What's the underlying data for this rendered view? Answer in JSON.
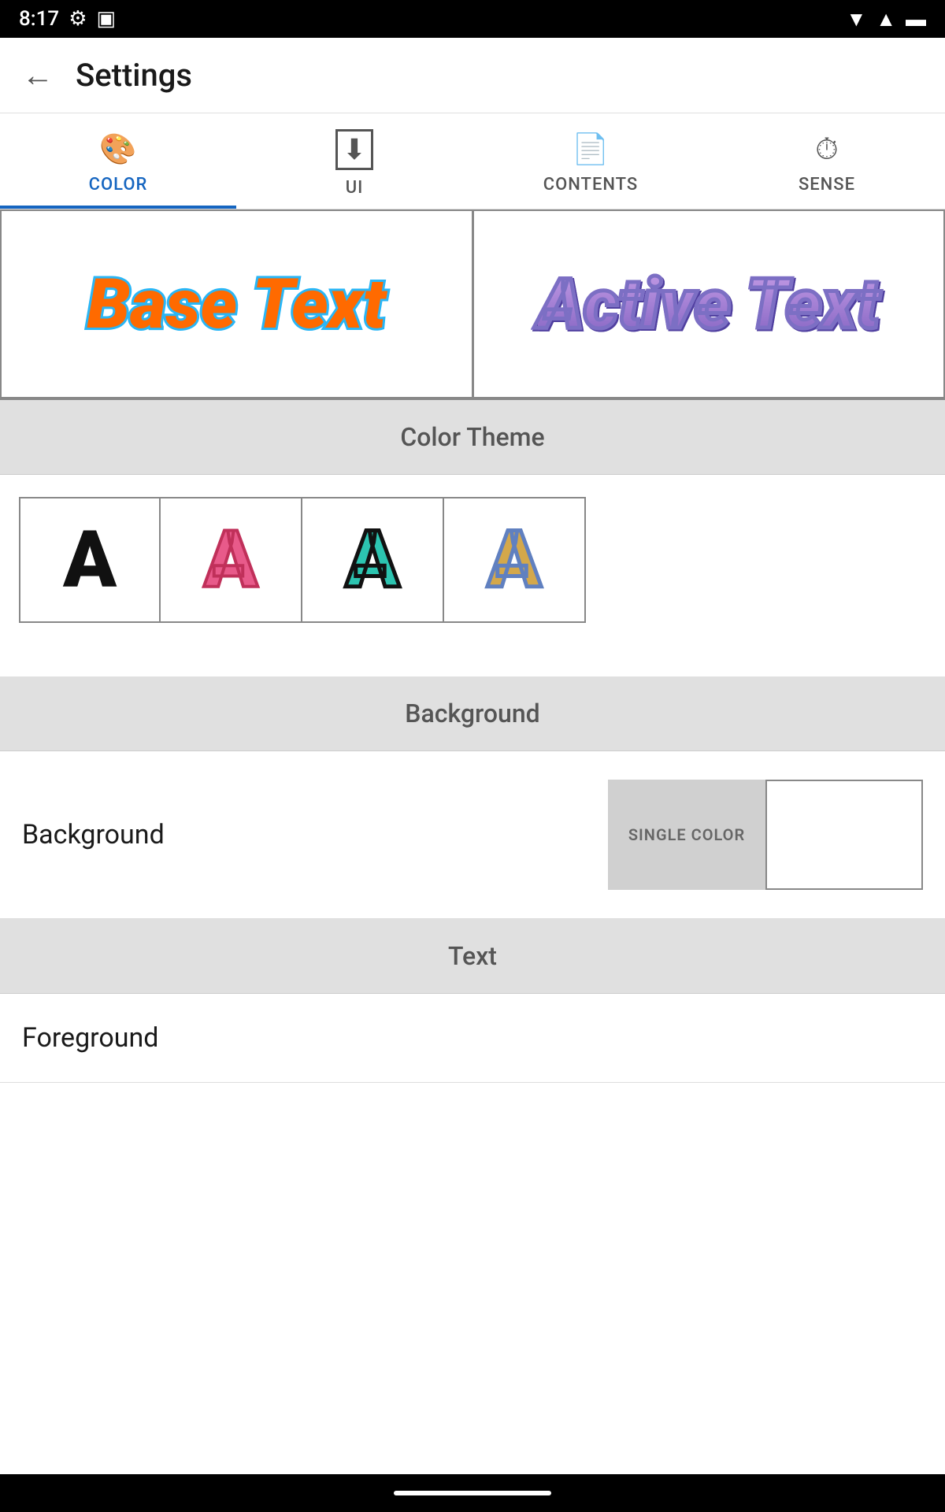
{
  "statusBar": {
    "time": "8:17",
    "icons": [
      "settings-icon",
      "battery-icon"
    ]
  },
  "appBar": {
    "title": "Settings",
    "backLabel": "←"
  },
  "tabs": [
    {
      "id": "color",
      "label": "COLOR",
      "icon": "🎨",
      "active": true
    },
    {
      "id": "ui",
      "label": "UI",
      "icon": "⬇",
      "active": false
    },
    {
      "id": "contents",
      "label": "CONTENTS",
      "icon": "📄",
      "active": false
    },
    {
      "id": "sense",
      "label": "SENSE",
      "icon": "⏱",
      "active": false
    }
  ],
  "preview": {
    "baseText": "Base Text",
    "activeText": "Active Text"
  },
  "colorTheme": {
    "label": "Color Theme",
    "options": [
      {
        "id": "plain",
        "char": "A"
      },
      {
        "id": "pink",
        "char": "A"
      },
      {
        "id": "teal",
        "char": "A"
      },
      {
        "id": "gold",
        "char": "A"
      }
    ]
  },
  "background": {
    "sectionLabel": "Background",
    "rowLabel": "Background",
    "singleColorLabel": "SINGLE COLOR",
    "options": [
      {
        "id": "single",
        "label": "SINGLE COLOR"
      },
      {
        "id": "white",
        "label": ""
      }
    ]
  },
  "text": {
    "sectionLabel": "Text",
    "foregroundLabel": "Foreground"
  }
}
